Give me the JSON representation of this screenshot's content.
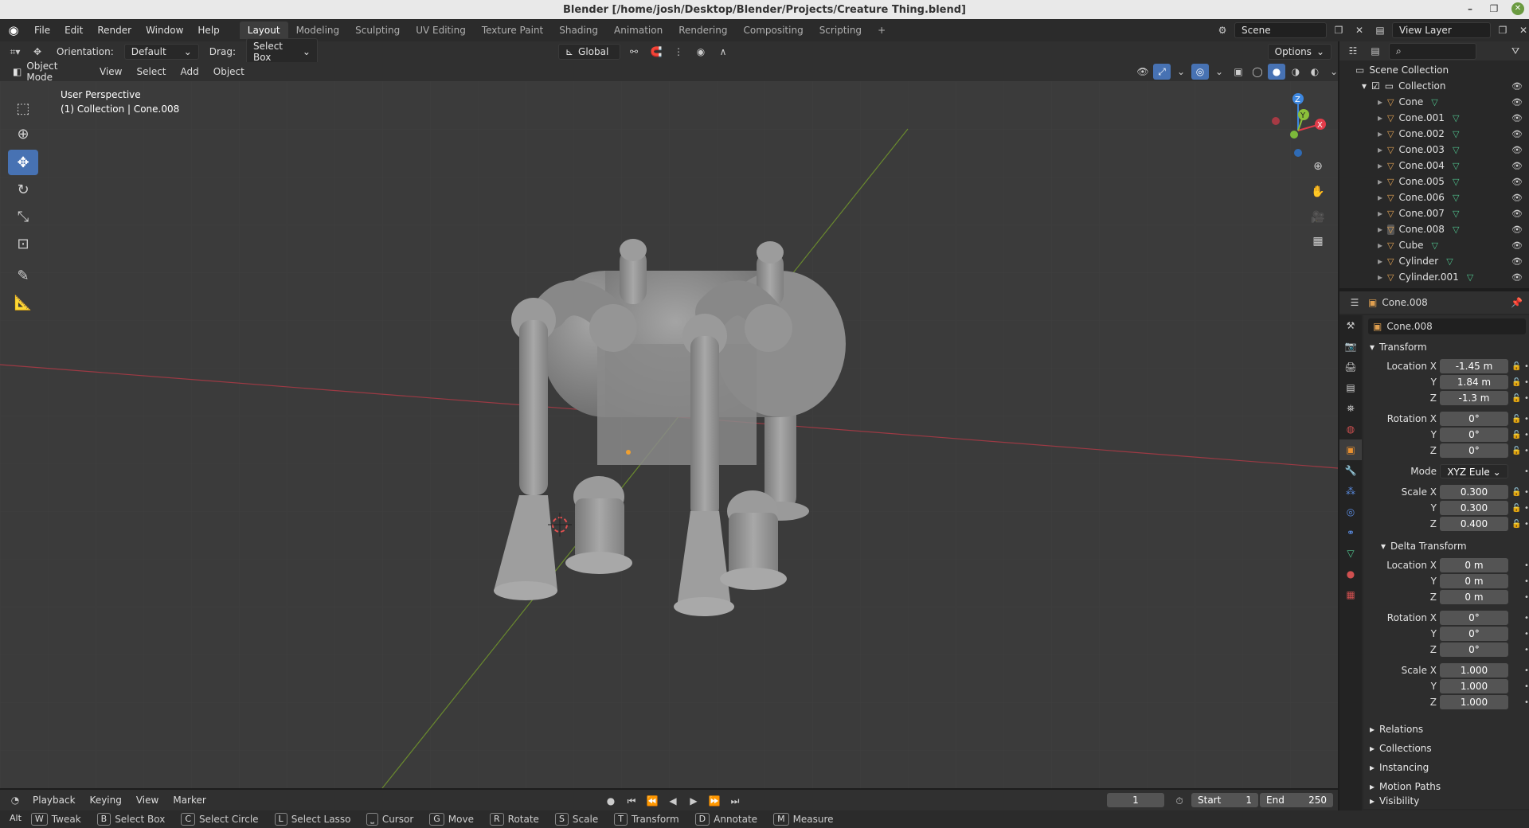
{
  "window": {
    "title": "Blender [/home/josh/Desktop/Blender/Projects/Creature Thing.blend]"
  },
  "menu": [
    "File",
    "Edit",
    "Render",
    "Window",
    "Help"
  ],
  "workspaces": [
    "Layout",
    "Modeling",
    "Sculpting",
    "UV Editing",
    "Texture Paint",
    "Shading",
    "Animation",
    "Rendering",
    "Compositing",
    "Scripting"
  ],
  "active_workspace": "Layout",
  "scene": {
    "name": "Scene",
    "view_layer": "View Layer"
  },
  "toolheader": {
    "orientation_label": "Orientation:",
    "orientation_value": "Default",
    "drag_label": "Drag:",
    "drag_value": "Select Box",
    "transform_orientation": "Global",
    "options_label": "Options"
  },
  "viewport_header": {
    "mode": "Object Mode",
    "menus": [
      "View",
      "Select",
      "Add",
      "Object"
    ]
  },
  "viewport": {
    "perspective": "User Perspective",
    "collection_info": "(1) Collection | Cone.008"
  },
  "gizmo": {
    "x": "X",
    "y": "Y",
    "z": "Z"
  },
  "outliner": {
    "root": "Scene Collection",
    "collection": "Collection",
    "objects": [
      "Cone",
      "Cone.001",
      "Cone.002",
      "Cone.003",
      "Cone.004",
      "Cone.005",
      "Cone.006",
      "Cone.007",
      "Cone.008",
      "Cube",
      "Cylinder",
      "Cylinder.001"
    ],
    "selected": "Cone.008"
  },
  "properties": {
    "object_name": "Cone.008",
    "datablock_name": "Cone.008",
    "transform": {
      "title": "Transform",
      "location_label": "Location X",
      "location": [
        "-1.45 m",
        "1.84 m",
        "-1.3 m"
      ],
      "rotation_label": "Rotation X",
      "rotation": [
        "0°",
        "0°",
        "0°"
      ],
      "mode_label": "Mode",
      "mode_value": "XYZ Eule",
      "scale_label": "Scale X",
      "scale": [
        "0.300",
        "0.300",
        "0.400"
      ],
      "y_label": "Y",
      "z_label": "Z"
    },
    "delta": {
      "title": "Delta Transform",
      "location": [
        "0 m",
        "0 m",
        "0 m"
      ],
      "rotation": [
        "0°",
        "0°",
        "0°"
      ],
      "scale": [
        "1.000",
        "1.000",
        "1.000"
      ]
    },
    "collapsed_sections": [
      "Relations",
      "Collections",
      "Instancing",
      "Motion Paths",
      "Visibility"
    ]
  },
  "timeline": {
    "menus": [
      "Playback",
      "Keying",
      "View",
      "Marker"
    ],
    "current_frame": "1",
    "start_label": "Start",
    "start": "1",
    "end_label": "End",
    "end": "250"
  },
  "statusbar": {
    "modifier": "Alt",
    "items": [
      {
        "key": "W",
        "label": "Tweak"
      },
      {
        "key": "B",
        "label": "Select Box"
      },
      {
        "key": "C",
        "label": "Select Circle"
      },
      {
        "key": "L",
        "label": "Select Lasso"
      },
      {
        "key": "⎵",
        "label": "Cursor"
      },
      {
        "key": "G",
        "label": "Move"
      },
      {
        "key": "R",
        "label": "Rotate"
      },
      {
        "key": "S",
        "label": "Scale"
      },
      {
        "key": "T",
        "label": "Transform"
      },
      {
        "key": "D",
        "label": "Annotate"
      },
      {
        "key": "M",
        "label": "Measure"
      }
    ]
  },
  "colors": {
    "accent": "#4772b3",
    "x_axis": "#e23c4a",
    "y_axis": "#8bc03a",
    "z_axis": "#3d87e0",
    "object_icon": "#e4a455",
    "mesh_icon": "#4fc28d"
  }
}
